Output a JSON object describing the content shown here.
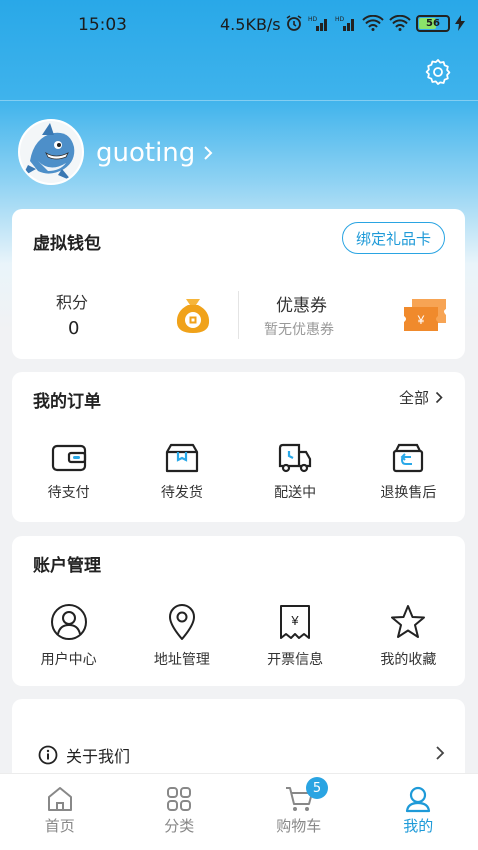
{
  "status_bar": {
    "time": "15:03",
    "network_speed": "4.5KB/s",
    "battery": "56"
  },
  "profile": {
    "username": "guoting"
  },
  "wallet": {
    "title": "虚拟钱包",
    "bind_button": "绑定礼品卡",
    "points_label": "积分",
    "points_value": "0",
    "coupon_label": "优惠券",
    "coupon_status": "暂无优惠券"
  },
  "orders": {
    "title": "我的订单",
    "all_link": "全部",
    "items": [
      {
        "label": "待支付",
        "icon": "wallet-icon"
      },
      {
        "label": "待发货",
        "icon": "package-icon"
      },
      {
        "label": "配送中",
        "icon": "delivery-truck-icon"
      },
      {
        "label": "退换售后",
        "icon": "return-box-icon"
      }
    ]
  },
  "account": {
    "title": "账户管理",
    "items": [
      {
        "label": "用户中心",
        "icon": "user-icon"
      },
      {
        "label": "地址管理",
        "icon": "location-pin-icon"
      },
      {
        "label": "开票信息",
        "icon": "invoice-icon"
      },
      {
        "label": "我的收藏",
        "icon": "star-icon"
      }
    ]
  },
  "about": {
    "label": "关于我们"
  },
  "tabbar": {
    "items": [
      {
        "label": "首页",
        "icon": "home-icon"
      },
      {
        "label": "分类",
        "icon": "category-icon"
      },
      {
        "label": "购物车",
        "icon": "cart-icon",
        "badge": "5"
      },
      {
        "label": "我的",
        "icon": "profile-icon",
        "active": true
      }
    ]
  },
  "colors": {
    "accent": "#1e9ad8",
    "header": "#29a8e8",
    "coin": "#f0a21a"
  }
}
